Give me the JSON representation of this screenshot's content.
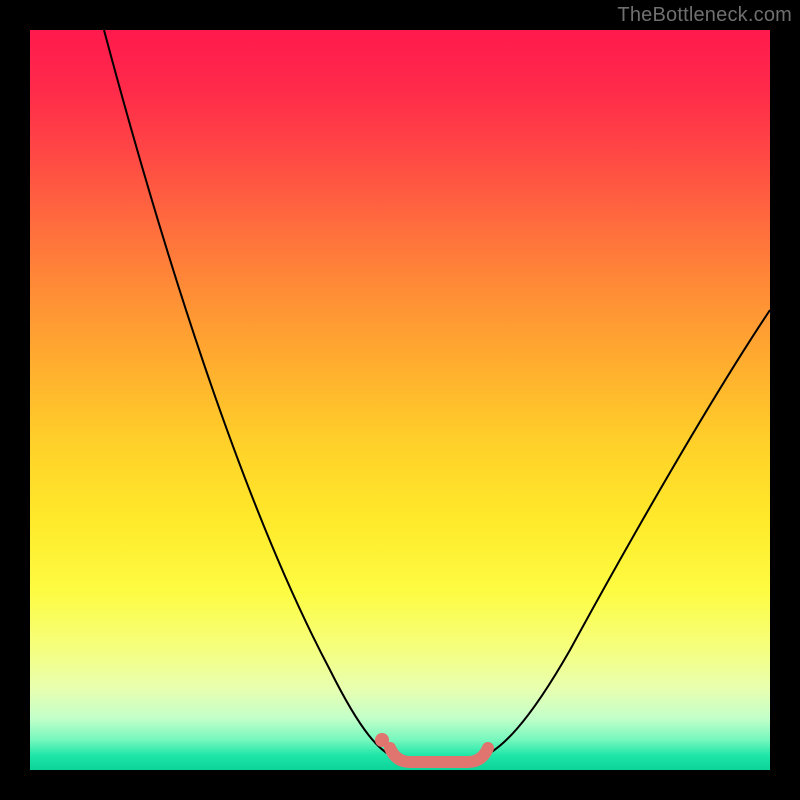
{
  "watermark": "TheBottleneck.com",
  "colors": {
    "curve": "#000000",
    "basin": "#e0746e",
    "frame": "#000000"
  },
  "chart_data": {
    "type": "line",
    "title": "",
    "xlabel": "",
    "ylabel": "",
    "xlim": [
      0,
      100
    ],
    "ylim": [
      0,
      100
    ],
    "grid": false,
    "legend": false,
    "series": [
      {
        "name": "bottleneck-curve",
        "x": [
          10,
          15,
          20,
          25,
          30,
          35,
          40,
          45,
          48,
          50,
          52,
          54,
          56,
          58,
          60,
          65,
          70,
          75,
          80,
          85,
          90,
          95,
          100
        ],
        "y": [
          100,
          87,
          74,
          61,
          48,
          35,
          22,
          11,
          5,
          2,
          1,
          0,
          0,
          0,
          1,
          4,
          9,
          16,
          24,
          33,
          42,
          52,
          62
        ]
      }
    ],
    "annotations": [
      {
        "name": "basin-highlight",
        "x_range": [
          48,
          60
        ],
        "y": 0
      }
    ]
  }
}
